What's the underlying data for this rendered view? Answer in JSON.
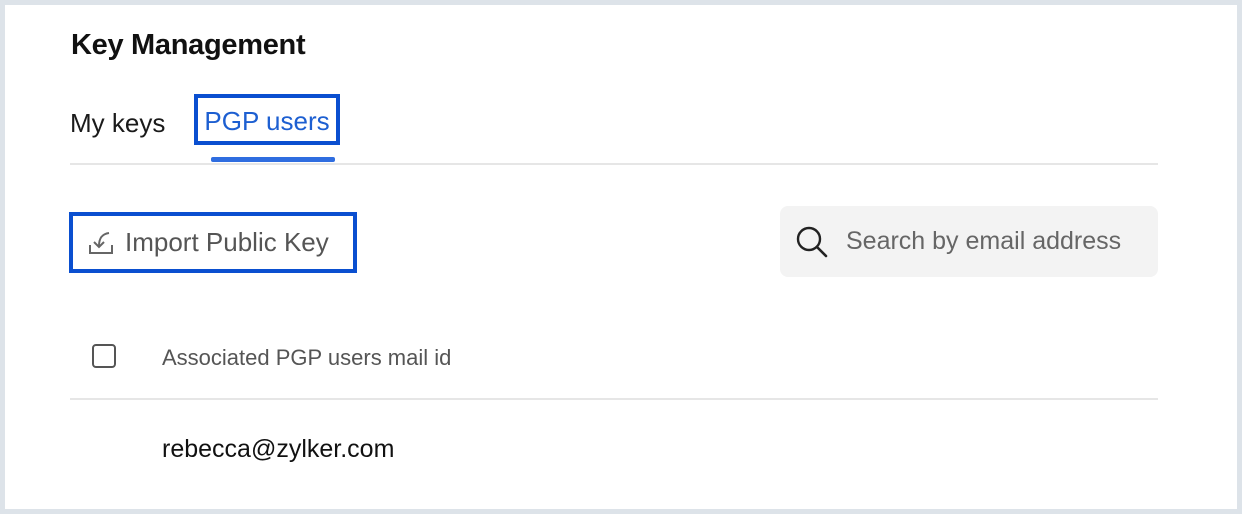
{
  "page": {
    "title": "Key Management"
  },
  "tabs": [
    {
      "label": "My keys",
      "active": false
    },
    {
      "label": "PGP users",
      "active": true
    }
  ],
  "toolbar": {
    "import_label": "Import Public Key",
    "import_icon": "import-tray-icon"
  },
  "search": {
    "placeholder": "Search by email address",
    "icon": "search-icon",
    "value": ""
  },
  "table": {
    "column_header": "Associated PGP users mail id",
    "rows": [
      {
        "email": "rebecca@zylker.com"
      }
    ]
  },
  "colors": {
    "accent": "#1d5fd1",
    "highlight_border": "#0a4fd0",
    "page_background": "#dde3e9"
  }
}
